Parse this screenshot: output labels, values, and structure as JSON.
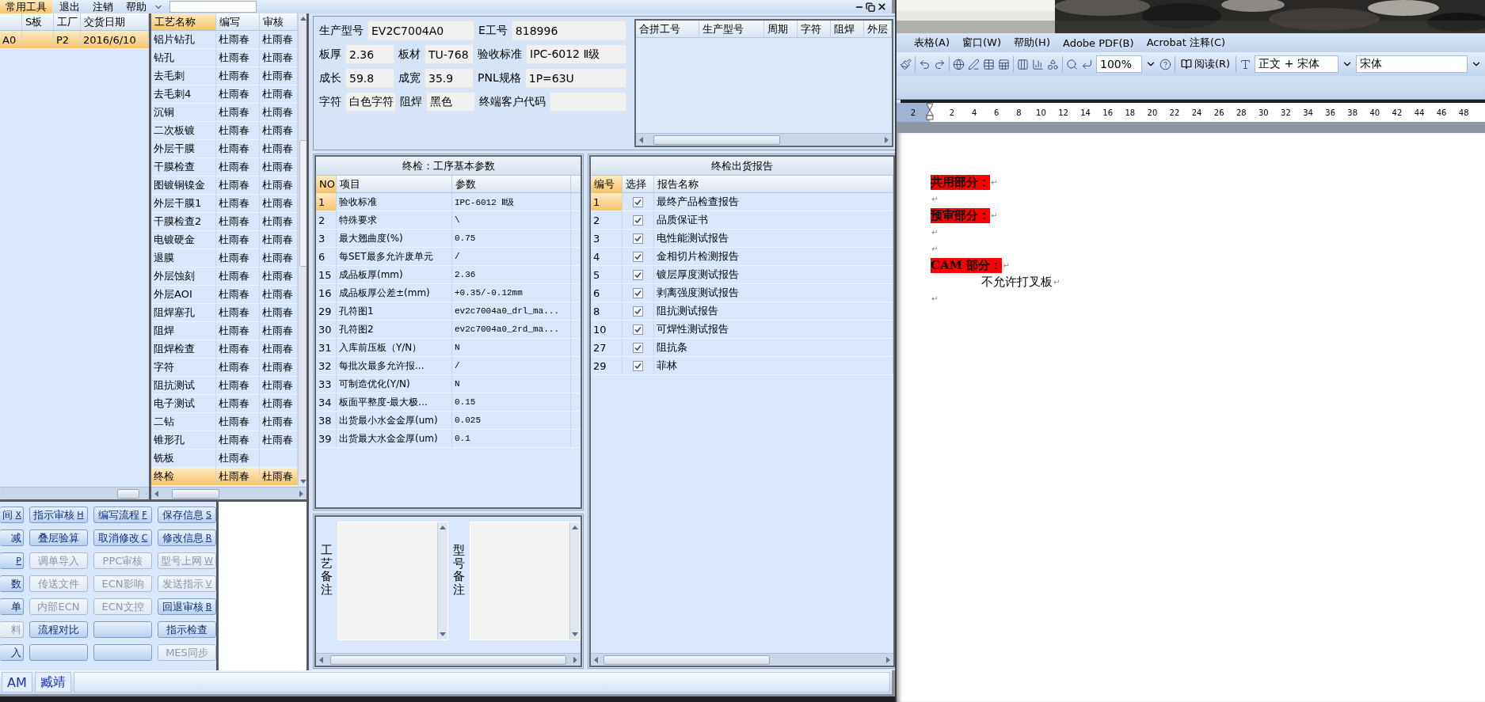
{
  "app": {
    "menu": [
      {
        "label": "常用工具",
        "selected": true
      },
      {
        "label": "退出",
        "selected": false
      },
      {
        "label": "注销",
        "selected": false
      },
      {
        "label": "帮助",
        "selected": false
      }
    ],
    "orders": {
      "columns": [
        "S板",
        "工厂",
        "交货日期"
      ],
      "rows": [
        {
          "code": "A0",
          "factory": "P2",
          "date": "2016/6/10",
          "selected": true
        }
      ]
    },
    "processes": {
      "columns": [
        {
          "label": "工艺名称",
          "active": true
        },
        {
          "label": "编写",
          "active": false
        },
        {
          "label": "审核",
          "active": false
        }
      ],
      "rows": [
        {
          "name": "铝片钻孔",
          "writer": "杜雨春",
          "reviewer": "杜雨春",
          "selected": false
        },
        {
          "name": "钻孔",
          "writer": "杜雨春",
          "reviewer": "杜雨春",
          "selected": false
        },
        {
          "name": "去毛刺",
          "writer": "杜雨春",
          "reviewer": "杜雨春",
          "selected": false
        },
        {
          "name": "去毛刺4",
          "writer": "杜雨春",
          "reviewer": "杜雨春",
          "selected": false
        },
        {
          "name": "沉铜",
          "writer": "杜雨春",
          "reviewer": "杜雨春",
          "selected": false
        },
        {
          "name": "二次板镀",
          "writer": "杜雨春",
          "reviewer": "杜雨春",
          "selected": false
        },
        {
          "name": "外层干膜",
          "writer": "杜雨春",
          "reviewer": "杜雨春",
          "selected": false
        },
        {
          "name": "干膜检查",
          "writer": "杜雨春",
          "reviewer": "杜雨春",
          "selected": false
        },
        {
          "name": "图镀铜镍金",
          "writer": "杜雨春",
          "reviewer": "杜雨春",
          "selected": false
        },
        {
          "name": "外层干膜1",
          "writer": "杜雨春",
          "reviewer": "杜雨春",
          "selected": false
        },
        {
          "name": "干膜检查2",
          "writer": "杜雨春",
          "reviewer": "杜雨春",
          "selected": false
        },
        {
          "name": "电镀硬金",
          "writer": "杜雨春",
          "reviewer": "杜雨春",
          "selected": false
        },
        {
          "name": "退膜",
          "writer": "杜雨春",
          "reviewer": "杜雨春",
          "selected": false
        },
        {
          "name": "外层蚀刻",
          "writer": "杜雨春",
          "reviewer": "杜雨春",
          "selected": false
        },
        {
          "name": "外层AOI",
          "writer": "杜雨春",
          "reviewer": "杜雨春",
          "selected": false
        },
        {
          "name": "阻焊塞孔",
          "writer": "杜雨春",
          "reviewer": "杜雨春",
          "selected": false
        },
        {
          "name": "阻焊",
          "writer": "杜雨春",
          "reviewer": "杜雨春",
          "selected": false
        },
        {
          "name": "阻焊检查",
          "writer": "杜雨春",
          "reviewer": "杜雨春",
          "selected": false
        },
        {
          "name": "字符",
          "writer": "杜雨春",
          "reviewer": "杜雨春",
          "selected": false
        },
        {
          "name": "阻抗测试",
          "writer": "杜雨春",
          "reviewer": "杜雨春",
          "selected": false
        },
        {
          "name": "电子测试",
          "writer": "杜雨春",
          "reviewer": "杜雨春",
          "selected": false
        },
        {
          "name": "二钻",
          "writer": "杜雨春",
          "reviewer": "杜雨春",
          "selected": false
        },
        {
          "name": "锥形孔",
          "writer": "杜雨春",
          "reviewer": "杜雨春",
          "selected": false
        },
        {
          "name": "铣板",
          "writer": "杜雨春",
          "selected": false
        },
        {
          "name": "终检",
          "writer": "杜雨春",
          "reviewer": "杜雨春",
          "selected": true
        }
      ]
    },
    "buttons": [
      [
        {
          "kind": "button",
          "label": "间",
          "key": "X",
          "disabled": false
        },
        {
          "kind": "button",
          "label": "指示审核",
          "key": "H",
          "disabled": false
        },
        {
          "kind": "button",
          "label": "编写流程",
          "key": "F",
          "disabled": false
        },
        {
          "kind": "button",
          "label": "保存信息",
          "key": "S",
          "disabled": false
        }
      ],
      [
        {
          "kind": "button",
          "label": "减",
          "disabled": false
        },
        {
          "kind": "button",
          "label": "叠层验算",
          "disabled": false
        },
        {
          "kind": "button",
          "label": "取消修改",
          "key": "C",
          "disabled": false
        },
        {
          "kind": "button",
          "label": "修改信息",
          "key": "R",
          "disabled": false
        }
      ],
      [
        {
          "kind": "button",
          "key": "P",
          "disabled": false
        },
        {
          "kind": "button",
          "label": "调单导入",
          "disabled": true
        },
        {
          "kind": "button",
          "label": "PPC审核",
          "disabled": true
        },
        {
          "kind": "button",
          "label": "型号上网",
          "key": "W",
          "disabled": true
        }
      ],
      [
        {
          "kind": "button",
          "label": "数",
          "disabled": false
        },
        {
          "kind": "button",
          "label": "传送文件",
          "disabled": true
        },
        {
          "kind": "button",
          "label": "ECN影响",
          "disabled": true
        },
        {
          "kind": "button",
          "label": "发送指示",
          "key": "V",
          "disabled": true
        }
      ],
      [
        {
          "kind": "button",
          "label": "单",
          "disabled": false
        },
        {
          "kind": "button",
          "label": "内部ECN",
          "disabled": true
        },
        {
          "kind": "button",
          "label": "ECN文控",
          "disabled": true
        },
        {
          "kind": "button",
          "label": "回退审核",
          "key": "B",
          "disabled": false
        }
      ],
      [
        {
          "kind": "button",
          "label": "料",
          "disabled": true
        },
        {
          "kind": "button",
          "label": "流程对比",
          "disabled": false
        },
        {
          "kind": "blank"
        },
        {
          "kind": "button",
          "label": "指示检查",
          "disabled": false
        }
      ],
      [
        {
          "kind": "button",
          "label": "入",
          "disabled": false
        },
        {
          "kind": "blank"
        },
        {
          "kind": "blank"
        },
        {
          "kind": "button",
          "label": "MES同步",
          "disabled": true
        }
      ]
    ],
    "info": [
      [
        {
          "label": "生产型号",
          "value": "EV2C7004A0"
        },
        {
          "label": "E工号",
          "value": "818996"
        }
      ],
      [
        {
          "label": "板厚",
          "value": "2.36"
        },
        {
          "label": "板材",
          "value": "TU-768"
        },
        {
          "label": "验收标准",
          "value": "IPC-6012 Ⅱ级"
        }
      ],
      [
        {
          "label": "成长",
          "value": "59.8"
        },
        {
          "label": "成宽",
          "value": "35.9"
        },
        {
          "label": "PNL规格",
          "value": "1P=63U"
        }
      ],
      [
        {
          "label": "字符",
          "value": "白色字符"
        },
        {
          "label": "阻焊",
          "value": "黑色"
        },
        {
          "label": "终端客户代码"
        }
      ]
    ],
    "merge_table": {
      "columns": [
        "合拼工号",
        "生产型号",
        "周期",
        "字符",
        "阻焊",
        "外层"
      ]
    },
    "params": {
      "title": "终检：工序基本参数",
      "columns": [
        "NO",
        "项目",
        "参数"
      ],
      "rows": [
        {
          "no": "1",
          "item": "验收标准",
          "value": "IPC-6012 Ⅱ级",
          "selected": true
        },
        {
          "no": "2",
          "item": "特殊要求",
          "value": "\\",
          "selected": false
        },
        {
          "no": "3",
          "item": "最大翘曲度(%)",
          "value": "0.75",
          "selected": false
        },
        {
          "no": "6",
          "item": "每SET最多允许废单元",
          "value": "/",
          "selected": false
        },
        {
          "no": "15",
          "item": "成品板厚(mm)",
          "value": "2.36",
          "selected": false
        },
        {
          "no": "16",
          "item": "成品板厚公差±(mm)",
          "value": "+0.35/-0.12mm",
          "selected": false
        },
        {
          "no": "29",
          "item": "孔符图1",
          "value": "ev2c7004a0_drl_ma...",
          "selected": false
        },
        {
          "no": "30",
          "item": "孔符图2",
          "value": "ev2c7004a0_2rd_ma...",
          "selected": false
        },
        {
          "no": "31",
          "item": "入库前压板（Y/N）",
          "value": "N",
          "selected": false
        },
        {
          "no": "32",
          "item": "每批次最多允许报...",
          "value": "/",
          "selected": false
        },
        {
          "no": "33",
          "item": "可制造优化(Y/N)",
          "value": "N",
          "selected": false
        },
        {
          "no": "34",
          "item": "板面平整度-最大极...",
          "value": "0.15",
          "selected": false
        },
        {
          "no": "38",
          "item": "出货最小水金金厚(um)",
          "value": "0.025",
          "selected": false
        },
        {
          "no": "39",
          "item": "出货最大水金金厚(um)",
          "value": "0.1",
          "selected": false
        }
      ]
    },
    "notes": [
      {
        "label": "工艺备注"
      },
      {
        "label": "型号备注"
      }
    ],
    "reports": {
      "title": "终检出货报告",
      "columns": [
        "编号",
        "选择",
        "报告名称"
      ],
      "rows": [
        {
          "no": "1",
          "name": "最终产品检查报告",
          "checked": true,
          "selected": true
        },
        {
          "no": "2",
          "name": "品质保证书",
          "checked": true,
          "selected": false
        },
        {
          "no": "3",
          "name": "电性能测试报告",
          "checked": true,
          "selected": false
        },
        {
          "no": "4",
          "name": "金相切片检测报告",
          "checked": true,
          "selected": false
        },
        {
          "no": "5",
          "name": "镀层厚度测试报告",
          "checked": true,
          "selected": false
        },
        {
          "no": "6",
          "name": "剥离强度测试报告",
          "checked": true,
          "selected": false
        },
        {
          "no": "8",
          "name": "阻抗测试报告",
          "checked": true,
          "selected": false
        },
        {
          "no": "10",
          "name": "可焊性测试报告",
          "checked": true,
          "selected": false
        },
        {
          "no": "27",
          "name": "阻抗条",
          "checked": true,
          "selected": false
        },
        {
          "no": "29",
          "name": "菲林",
          "checked": true,
          "selected": false
        }
      ]
    },
    "status": [
      "AM",
      "臧靖"
    ]
  },
  "word": {
    "menu": [
      "表格(A)",
      "窗口(W)",
      "帮助(H)",
      "Adobe PDF(B)",
      "Acrobat 注释(C)"
    ],
    "toolbar": {
      "zoom": "100%",
      "read": "阅读(R)",
      "style": "正文 + 宋体",
      "font": "宋体"
    },
    "ruler": [
      "2",
      "2",
      "4",
      "6",
      "8",
      "10",
      "12",
      "14",
      "16",
      "18",
      "20",
      "22",
      "24",
      "26",
      "28",
      "30",
      "32",
      "34",
      "36",
      "38",
      "40",
      "42",
      "44",
      "46",
      "48"
    ],
    "paragraphs": [
      {
        "text": "共用部分：",
        "highlight": true,
        "mark": "↵"
      },
      {
        "mark": "↵"
      },
      {
        "text": "预审部分：",
        "highlight": true,
        "mark": "↵"
      },
      {
        "mark": "↵"
      },
      {
        "mark": "↵"
      },
      {
        "text": "CAM 部分：",
        "highlight": true,
        "mark": "↵"
      },
      {
        "text": "不允许打叉板",
        "highlight": false,
        "indent": true,
        "mark": "↵"
      },
      {
        "mark": "↵"
      }
    ]
  }
}
